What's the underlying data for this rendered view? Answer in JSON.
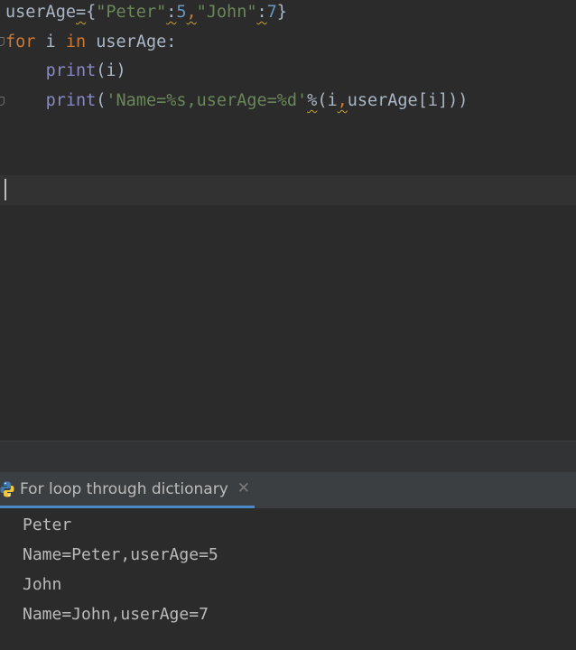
{
  "editor": {
    "line1": {
      "var": "userAge",
      "eq": "=",
      "brace_open": "{",
      "key1": "\"Peter\"",
      "colon1": ":",
      "val1": "5",
      "comma": ",",
      "key2": "\"John\"",
      "colon2": ":",
      "val2": "7",
      "brace_close": "}"
    },
    "line2": {
      "kw_for": "for",
      "loop_var": " i ",
      "kw_in": "in",
      "iterable": " userAge:"
    },
    "line3": {
      "indent": "    ",
      "func": "print",
      "args": "(i)"
    },
    "line4": {
      "indent": "    ",
      "func": "print",
      "paren_open": "(",
      "fmt_string": "'Name=%s,userAge=%d'",
      "percent": "%",
      "tuple_open": "(i",
      "tuple_comma": ",",
      "tuple_rest": "userAge[i]))"
    }
  },
  "run_panel": {
    "tab_label": "For loop through dictionary",
    "close_glyph": "✕",
    "output": [
      "Peter",
      "Name=Peter,userAge=5",
      "John",
      "Name=John,userAge=7"
    ]
  },
  "colors": {
    "keyword": "#cc7832",
    "string": "#6a8759",
    "number": "#6897bb",
    "builtin": "#8888c6",
    "text": "#a9b7c6",
    "accent": "#4a88c7"
  }
}
